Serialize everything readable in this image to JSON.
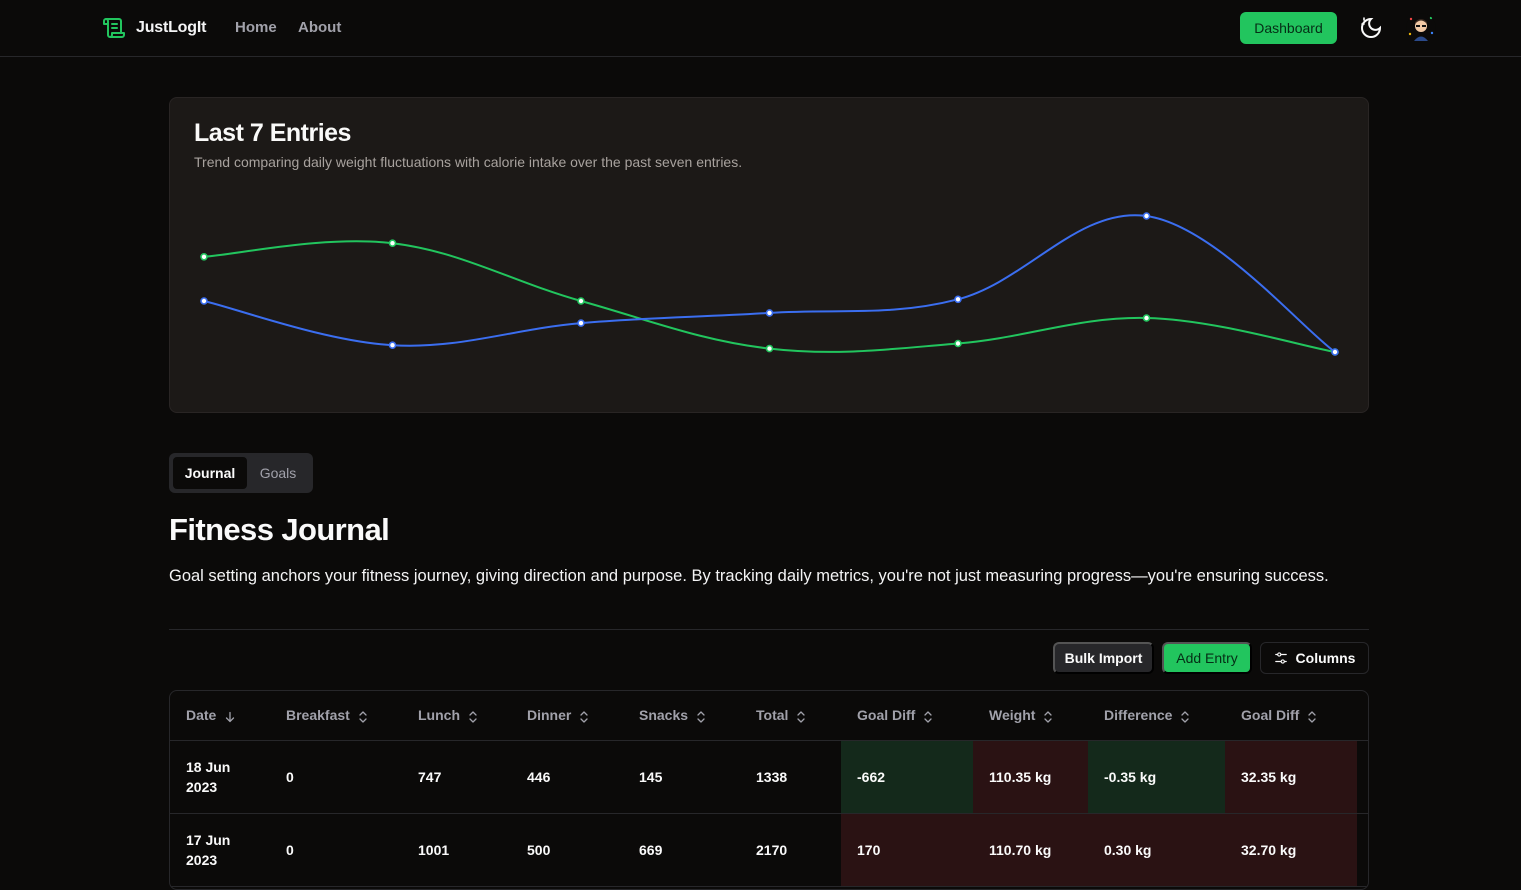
{
  "nav": {
    "brand": "JustLogIt",
    "links": [
      "Home",
      "About"
    ],
    "dashboard_label": "Dashboard"
  },
  "chart_card": {
    "title": "Last 7 Entries",
    "subtitle": "Trend comparing daily weight fluctuations with calorie intake over the past seven entries."
  },
  "chart_data": {
    "type": "line",
    "x": [
      1,
      2,
      3,
      4,
      5,
      6,
      7
    ],
    "series": [
      {
        "color": "#22c55e",
        "values": [
          0.76,
          0.84,
          0.5,
          0.22,
          0.25,
          0.4,
          0.2
        ]
      },
      {
        "color": "#3b6ef0",
        "values": [
          0.5,
          0.24,
          0.37,
          0.43,
          0.51,
          1.0,
          0.2
        ]
      }
    ],
    "title": "",
    "xlabel": "",
    "ylabel": "",
    "grid": false,
    "legend": "none"
  },
  "tabs": [
    "Journal",
    "Goals"
  ],
  "page": {
    "title": "Fitness Journal",
    "description": "Goal setting anchors your fitness journey, giving direction and purpose. By tracking daily metrics, you're not just measuring progress—you're ensuring success."
  },
  "actions": {
    "bulk_import": "Bulk Import",
    "add_entry": "Add Entry",
    "columns": "Columns"
  },
  "table": {
    "columns": [
      "Date",
      "Breakfast",
      "Lunch",
      "Dinner",
      "Snacks",
      "Total",
      "Goal Diff",
      "Weight",
      "Difference",
      "Goal Diff"
    ],
    "rows": [
      {
        "date_day": "18 Jun",
        "date_year": "2023",
        "breakfast": "0",
        "lunch": "747",
        "dinner": "446",
        "snacks": "145",
        "total": "1338",
        "goal_diff": "-662",
        "weight": "110.35 kg",
        "difference": "-0.35 kg",
        "weight_goal_diff": "32.35 kg"
      },
      {
        "date_day": "17 Jun",
        "date_year": "2023",
        "breakfast": "0",
        "lunch": "1001",
        "dinner": "500",
        "snacks": "669",
        "total": "2170",
        "goal_diff": "170",
        "weight": "110.70 kg",
        "difference": "0.30 kg",
        "weight_goal_diff": "32.70 kg"
      }
    ]
  },
  "colors": {
    "accent": "#22c55e",
    "weight_line": "#3b6ef0",
    "good_cell": "#14291b",
    "bad_cell": "#2a1213"
  }
}
